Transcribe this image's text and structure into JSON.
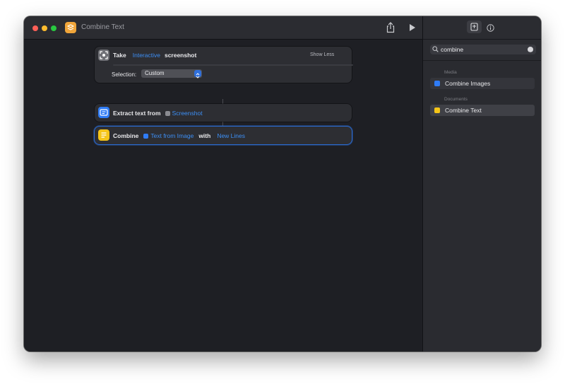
{
  "window": {
    "title": "Combine Text",
    "traffic_lights": {
      "close": "#ff5f57",
      "minimize": "#febc2e",
      "zoom": "#28c840"
    },
    "app_icon": "shortcuts-app-icon"
  },
  "toolbar": {
    "share_icon": "share-icon",
    "run_icon": "play-icon"
  },
  "actions": [
    {
      "icon": "screenshot-icon",
      "verb": "Take",
      "mode_token": "Interactive",
      "object": "screenshot",
      "show_less": "Show Less",
      "selection_label": "Selection:",
      "selection_value": "Custom"
    },
    {
      "icon": "extract-text-icon",
      "text": "Extract text from",
      "variable": "Screenshot"
    },
    {
      "icon": "combine-text-icon",
      "verb": "Combine",
      "variable": "Text from Image",
      "with": "with",
      "separator": "New Lines"
    }
  ],
  "sidebar": {
    "search": {
      "value": "combine",
      "clear_icon": "clear-icon"
    },
    "sections": [
      {
        "heading": "Media",
        "items": [
          {
            "label": "Combine Images",
            "icon_color": "#2f7cf6"
          }
        ]
      },
      {
        "heading": "Documents",
        "items": [
          {
            "label": "Combine Text",
            "icon_color": "#f5c518"
          }
        ]
      }
    ]
  },
  "colors": {
    "accent": "#3d8ff5",
    "window_bg": "#1e1f24",
    "card_bg": "#2d2e33"
  }
}
